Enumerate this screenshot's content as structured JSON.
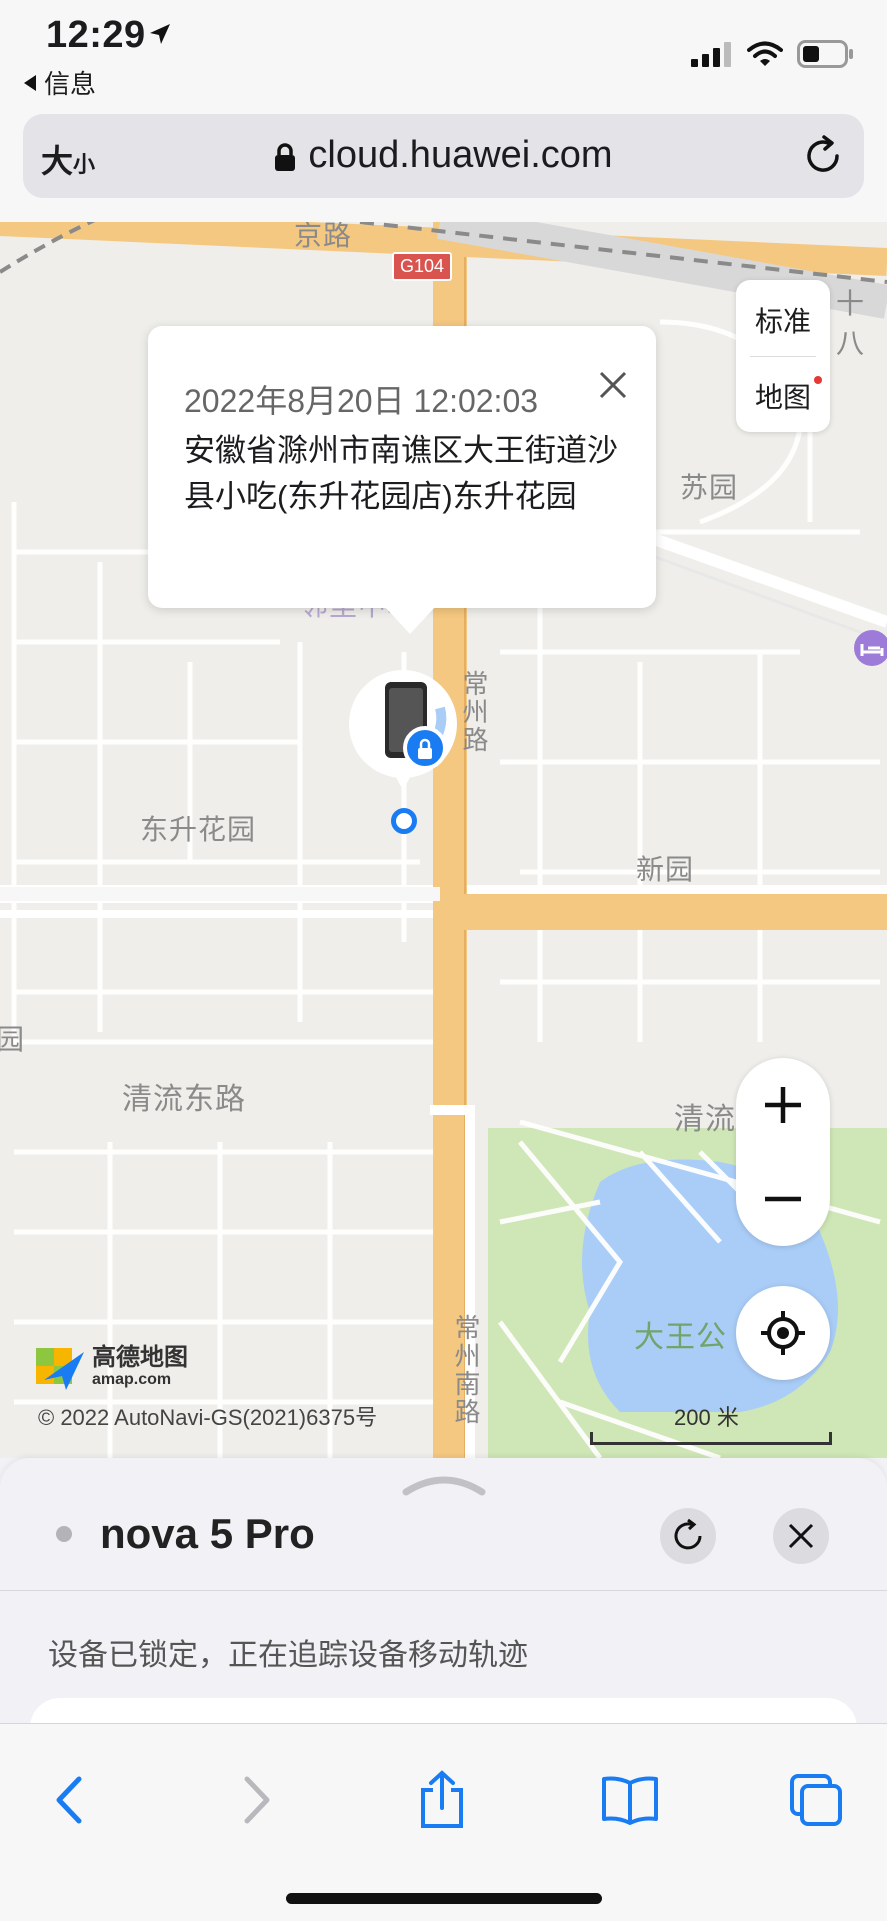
{
  "status_bar": {
    "time": "12:29",
    "back_app": "信息"
  },
  "address_bar": {
    "text_size": "大",
    "text_size_small": "小",
    "url": "cloud.huawei.com"
  },
  "map": {
    "road_badge": "G104",
    "labels": {
      "suyuan": "苏园",
      "dongsheng": "东升花园",
      "xinyuan": "新园",
      "qingliu_east": "清流东路",
      "qingliu": "清流",
      "changzhou1": "常州路",
      "changzhou2": "常州南路",
      "dawang": "大王公",
      "linli": "邻里中心",
      "edge_yuan": "园",
      "top_road": "京路",
      "top_right": "十八"
    },
    "popup": {
      "datetime": "2022年8月20日 12:02:03",
      "address": "安徽省滁州市南谯区大王街道沙县小吃(东升花园店)东升花园"
    },
    "map_type": {
      "line1": "标准",
      "line2": "地图"
    },
    "attribution": {
      "logo_cn": "高德地图",
      "logo_en": "amap.com",
      "copyright": "© 2022 AutoNavi-GS(2021)6375号"
    },
    "scale": "200 米"
  },
  "sheet": {
    "device_name": "nova 5 Pro",
    "status": "设备已锁定，正在追踪设备移动轨迹"
  },
  "colors": {
    "accent": "#1a7cf2",
    "road": "#f5c881",
    "park": "#cfe7b6",
    "water": "#a9cdf7"
  }
}
